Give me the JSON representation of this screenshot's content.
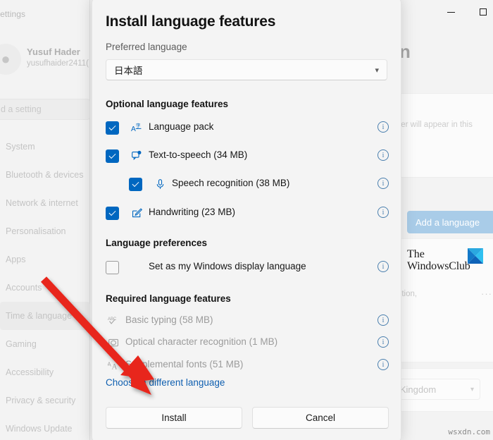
{
  "background": {
    "app_title": "Settings",
    "account": {
      "name": "Yusuf Hader",
      "email": "yusufhaider2411("
    },
    "search_placeholder": "d a setting",
    "nav_items": [
      {
        "label": "System",
        "selected": false
      },
      {
        "label": "Bluetooth & devices",
        "selected": false
      },
      {
        "label": "Network & internet",
        "selected": false
      },
      {
        "label": "Personalisation",
        "selected": false
      },
      {
        "label": "Apps",
        "selected": false
      },
      {
        "label": "Accounts",
        "selected": false
      },
      {
        "label": "Time & language",
        "selected": true
      },
      {
        "label": "Gaming",
        "selected": false
      },
      {
        "label": "Accessibility",
        "selected": false
      },
      {
        "label": "Privacy & security",
        "selected": false
      },
      {
        "label": "Windows Update",
        "selected": false
      }
    ],
    "page_heading_fragment": "n",
    "card_text_fragment": "orer will appear in this",
    "add_language_button": "Add a language",
    "language_subtext_fragment": "gnition,",
    "overflow_menu": "···",
    "region_value_fragment": "d Kingdom",
    "window_buttons": {
      "minimize": "minimize-icon",
      "maximize": "maximize-icon"
    }
  },
  "watermark": {
    "line1": "The",
    "line2": "WindowsClub",
    "source": "wsxdn.com"
  },
  "dialog": {
    "title": "Install language features",
    "preferred_language_label": "Preferred language",
    "preferred_language_value": "日本語",
    "optional_section_title": "Optional language features",
    "optional_features": [
      {
        "label": "Language pack",
        "checked": true,
        "indent": false,
        "icon": "language-pack-icon",
        "info": "i"
      },
      {
        "label": "Text-to-speech (34 MB)",
        "checked": true,
        "indent": false,
        "icon": "text-to-speech-icon",
        "info": "i"
      },
      {
        "label": "Speech recognition (38 MB)",
        "checked": true,
        "indent": true,
        "icon": "microphone-icon",
        "info": "i"
      },
      {
        "label": "Handwriting (23 MB)",
        "checked": true,
        "indent": false,
        "icon": "handwriting-icon",
        "info": "i"
      }
    ],
    "preferences_section_title": "Language preferences",
    "preferences": [
      {
        "label": "Set as my Windows display language",
        "checked": false,
        "info": "i"
      }
    ],
    "required_section_title": "Required language features",
    "required_features": [
      {
        "label": "Basic typing (58 MB)",
        "icon": "abc-check-icon",
        "info": "i"
      },
      {
        "label": "Optical character recognition (1 MB)",
        "icon": "ocr-icon",
        "info": "i"
      },
      {
        "label": "Supplemental fonts (51 MB)",
        "icon": "fonts-icon",
        "info": "i"
      }
    ],
    "choose_different_link": "Choose a different language",
    "install_button": "Install",
    "cancel_button": "Cancel"
  },
  "annotation": {
    "arrow_color": "#e8251c"
  },
  "colors": {
    "accent": "#0067c0",
    "link": "#0f5fb0",
    "info_icon": "#4a7fae",
    "dialog_bg": "#f4f4f4",
    "faded_accent": "#a9cce8"
  }
}
